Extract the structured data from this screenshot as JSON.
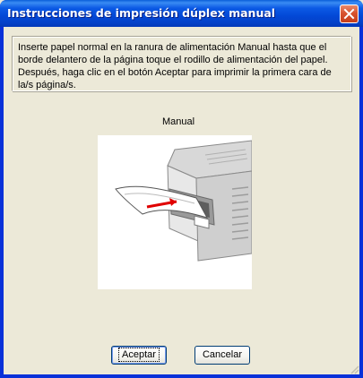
{
  "window": {
    "title": "Instrucciones de impresión dúplex manual"
  },
  "instructions": {
    "text": "Inserte papel normal en la ranura de alimentación Manual hasta que el borde delantero de la página toque el rodillo de alimentación del papel. Después, haga clic en el botón Aceptar para imprimir la primera cara de la/s página/s."
  },
  "illustration": {
    "caption": "Manual",
    "icon": "printer-manual-feed-illustration",
    "arrow_color": "#e00000"
  },
  "buttons": {
    "ok_label": "Aceptar",
    "cancel_label": "Cancelar"
  },
  "colors": {
    "titlebar": "#0348d6",
    "client": "#ece9d8",
    "close": "#d8532f"
  }
}
